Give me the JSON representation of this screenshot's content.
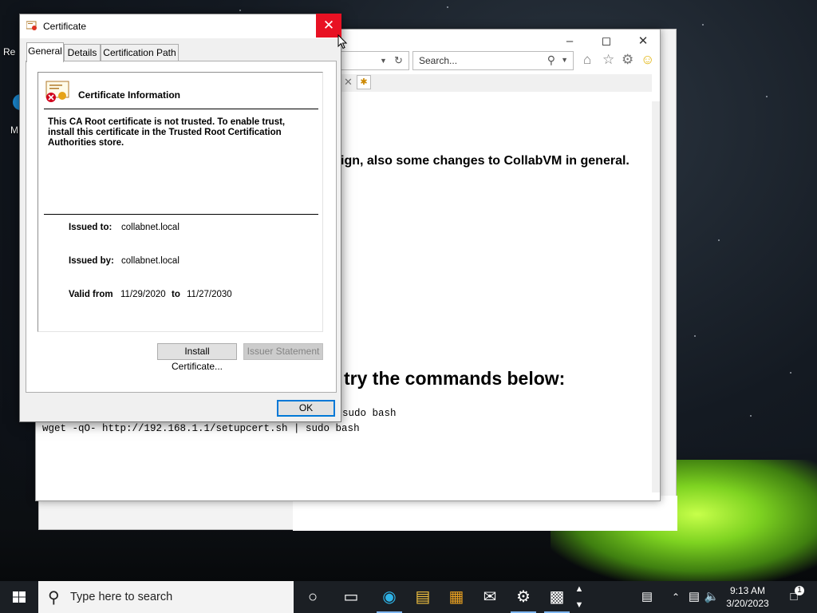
{
  "desktop": {
    "icons": [
      {
        "label": "Re"
      },
      {
        "label": "M"
      }
    ]
  },
  "browser": {
    "search_placeholder": "Search...",
    "headline": "ign, also some changes to CollabVM in general.",
    "heading2": "try the commands below:",
    "commands": [
      "sudo bash",
      "wget -qO- http://192.168.1.1/setupcert.sh | sudo bash"
    ]
  },
  "dialog": {
    "title": "Certificate",
    "close_glyph": "✕",
    "tabs": [
      "General",
      "Details",
      "Certification Path"
    ],
    "active_tab": "General",
    "info_title": "Certificate Information",
    "warning": "This CA Root certificate is not trusted. To enable trust, install this certificate in the Trusted Root Certification Authorities store.",
    "issued_to_label": "Issued to:",
    "issued_to": "collabnet.local",
    "issued_by_label": "Issued by:",
    "issued_by": "collabnet.local",
    "valid_from_label": "Valid from",
    "valid_from": "11/29/2020",
    "to_label": "to",
    "valid_to": "11/27/2030",
    "install_button": "Install Certificate...",
    "issuer_button": "Issuer Statement",
    "ok_button": "OK"
  },
  "taskbar": {
    "search_placeholder": "Type here to search",
    "time": "9:13 AM",
    "date": "3/20/2023",
    "notification_count": "1"
  },
  "colors": {
    "close_red": "#e81123",
    "focus_blue": "#0078d7",
    "taskbar": "#1b1f24"
  }
}
